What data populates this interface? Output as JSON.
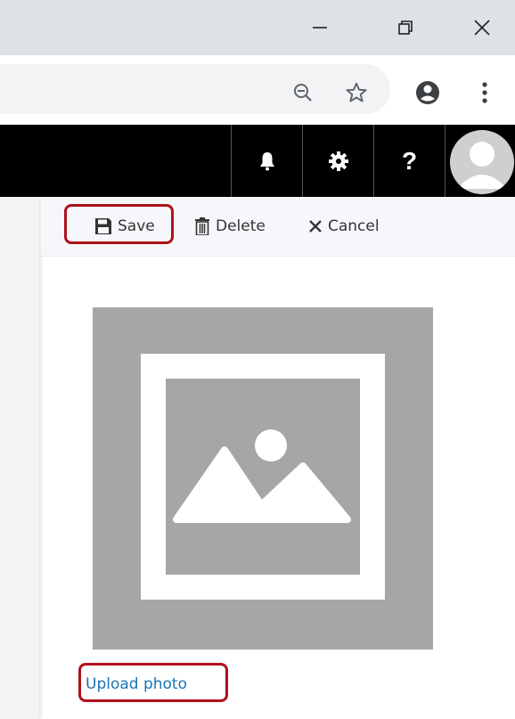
{
  "window_controls": {
    "minimize_icon": "minimize-icon",
    "restore_icon": "restore-icon",
    "close_icon": "close-icon"
  },
  "browser_toolbar": {
    "zoom_icon": "zoom-out-icon",
    "bookmark_icon": "star-icon",
    "profile_icon": "profile-icon",
    "menu_icon": "kebab-menu-icon"
  },
  "app_header": {
    "notifications_icon": "bell-icon",
    "settings_icon": "gear-icon",
    "help_label": "?",
    "avatar_icon": "user-avatar-icon"
  },
  "command_bar": {
    "save_label": "Save",
    "delete_label": "Delete",
    "cancel_label": "Cancel"
  },
  "photo": {
    "placeholder_icon": "image-placeholder-icon",
    "upload_label": "Upload photo"
  },
  "colors": {
    "highlight": "#b0121b",
    "link": "#1a73b8",
    "placeholder_bg": "#a6a6a6"
  }
}
